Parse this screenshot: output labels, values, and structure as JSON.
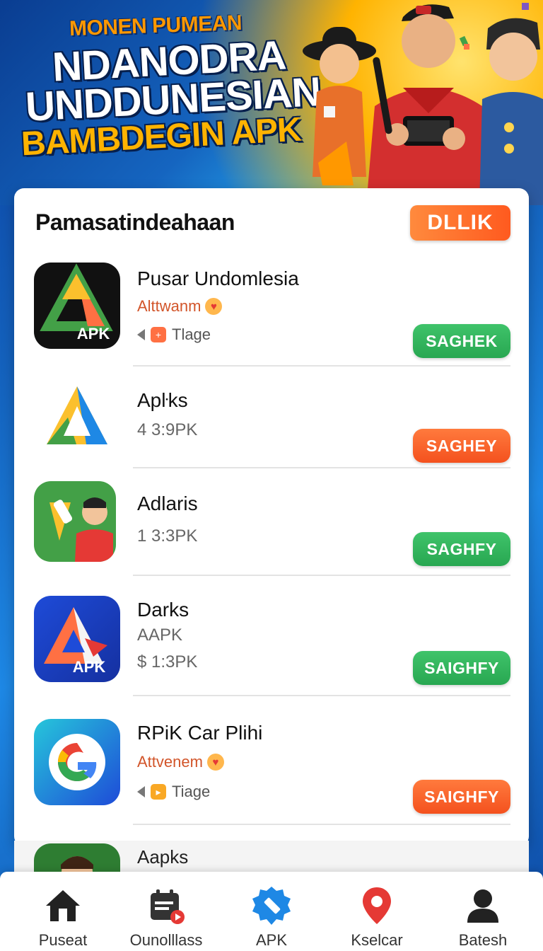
{
  "hero": {
    "kicker": "MONEN PUMEAN",
    "title_line1": "NDANODRA",
    "title_line2": "UNDDUNESIAN",
    "title_line3": "BAMBDEGIN APK"
  },
  "card": {
    "title": "Pamasatindeahaan",
    "header_button": "DLLIK"
  },
  "apps": [
    {
      "name": "Pusar Undomlesia",
      "developer": "Alttwanm",
      "tag": "Tlage",
      "button": "SAGHEK",
      "button_color": "#2eb356"
    },
    {
      "name": "Apŀks",
      "meta": "4 3:9PK",
      "button": "SAGHEY",
      "button_color": "#f4511e"
    },
    {
      "name": "Adlaris",
      "meta": "1 3:3PK",
      "button": "SAGHFY",
      "button_color": "#2eb356"
    },
    {
      "name": "Darks",
      "meta": "AAPK",
      "meta2": "$ 1:3PK",
      "button": "SAIGHFY",
      "button_color": "#2eb356"
    },
    {
      "name": "RPiK Car Plihi",
      "developer": "Attvenem",
      "tag": "Tiage",
      "button": "SAIGHFY",
      "button_color": "#f4511e"
    }
  ],
  "peek_app": {
    "name": "Aapks"
  },
  "icons": {
    "app1": "apk-triangle-icon",
    "app2": "apk-triangle-icon",
    "app3": "character-app-icon",
    "app4": "apk-logo-icon",
    "app5": "google-g-icon"
  },
  "icon_labels": {
    "app1": "APK",
    "app4": "APK"
  },
  "bottom_nav": [
    {
      "label": "Puseat",
      "icon": "home-icon"
    },
    {
      "label": "Ounolllass",
      "icon": "calendar-icon"
    },
    {
      "label": "APK",
      "icon": "apk-badge-icon"
    },
    {
      "label": "Kselcar",
      "icon": "location-pin-icon"
    },
    {
      "label": "Batesh",
      "icon": "profile-icon"
    }
  ]
}
